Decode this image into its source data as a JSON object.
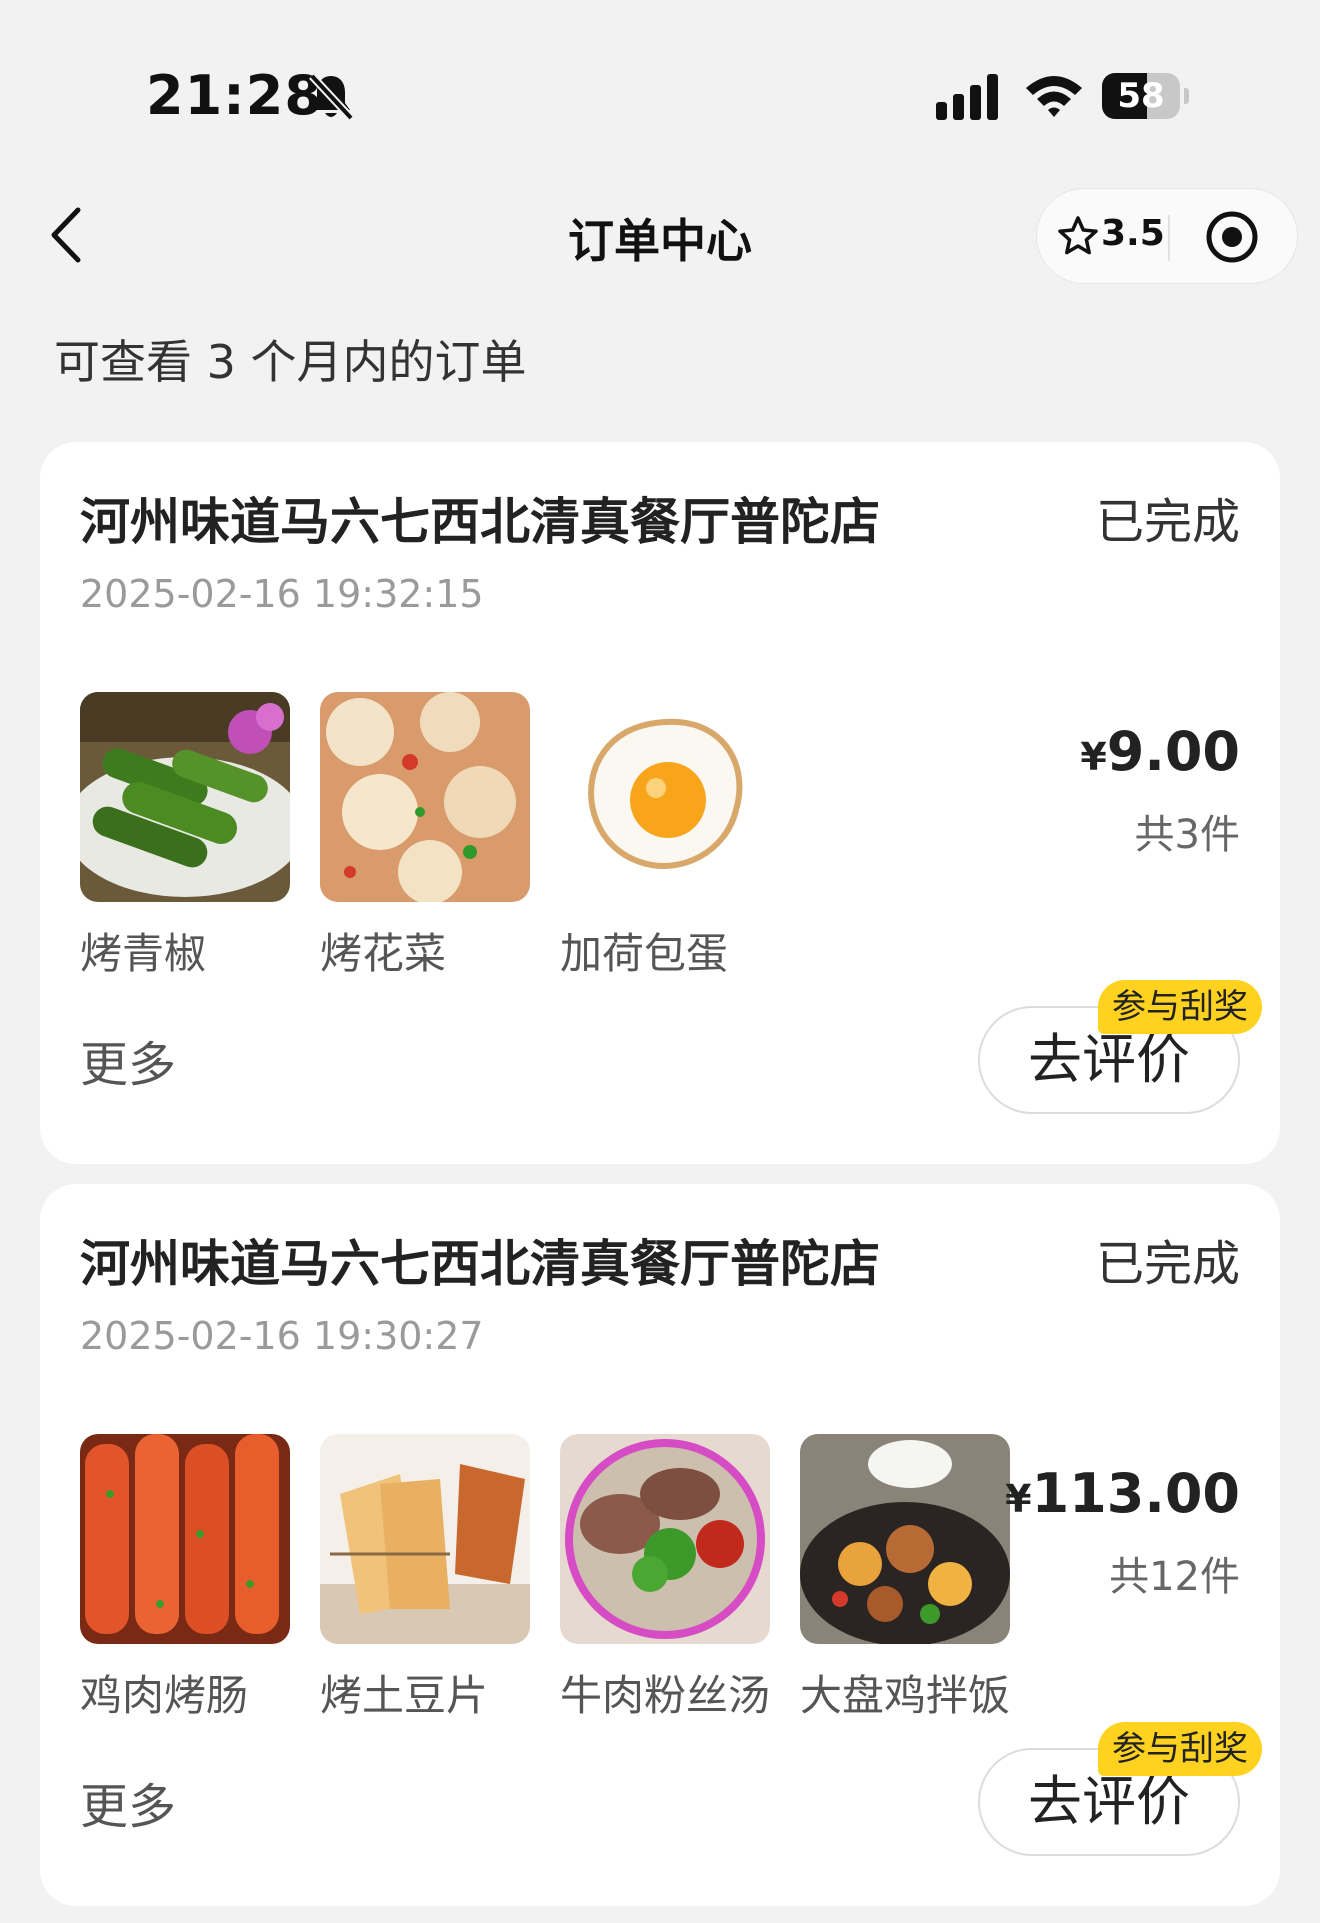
{
  "status_bar": {
    "time": "21:28",
    "battery": "58",
    "battery_level": 0.58,
    "icons": [
      "bell-slash-icon",
      "signal-icon",
      "wifi-icon",
      "battery-icon"
    ]
  },
  "nav": {
    "title": "订单中心",
    "rating": "3.5",
    "icons": [
      "chevron-left-icon",
      "star-icon",
      "target-icon"
    ]
  },
  "notice": "可查看 3 个月内的订单",
  "orders": [
    {
      "shop": "河州味道马六七西北清真餐厅普陀店",
      "status": "已完成",
      "time": "2025-02-16 19:32:15",
      "currency": "¥",
      "price": "9.00",
      "count": "共3件",
      "items": [
        {
          "name": "烤青椒",
          "image": "grilled-green-pepper"
        },
        {
          "name": "烤花菜",
          "image": "grilled-cauliflower"
        },
        {
          "name": "加荷包蛋",
          "image": "fried-egg"
        }
      ],
      "more": "更多",
      "review_button": "去评价",
      "badge": "参与刮奖"
    },
    {
      "shop": "河州味道马六七西北清真餐厅普陀店",
      "status": "已完成",
      "time": "2025-02-16 19:30:27",
      "currency": "¥",
      "price": "113.00",
      "count": "共12件",
      "items": [
        {
          "name": "鸡肉烤肠",
          "image": "chicken-sausage-skewers"
        },
        {
          "name": "烤土豆片",
          "image": "grilled-potato-slices"
        },
        {
          "name": "牛肉粉丝汤",
          "image": "beef-vermicelli-soup"
        },
        {
          "name": "大盘鸡拌饭",
          "image": "big-plate-chicken-rice"
        }
      ],
      "more": "更多",
      "review_button": "去评价",
      "badge": "参与刮奖"
    }
  ]
}
